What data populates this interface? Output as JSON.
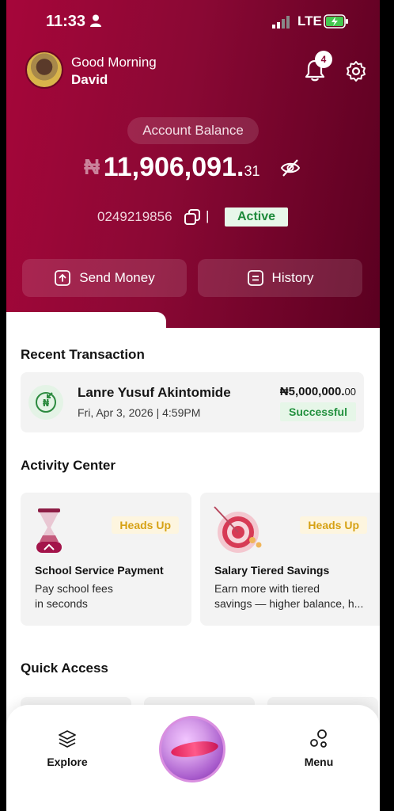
{
  "status_bar": {
    "time": "11:33",
    "network": "LTE"
  },
  "header": {
    "greeting": "Good Morning",
    "name": "David",
    "notification_count": "4"
  },
  "account": {
    "balance_label": "Account Balance",
    "currency": "₦",
    "balance_main": "11,906,091.",
    "balance_decimal": "31",
    "account_number": "0249219856",
    "separator": "|",
    "status": "Active"
  },
  "actions": {
    "send_money": "Send Money",
    "history": "History"
  },
  "recent_transaction": {
    "title": "Recent Transaction",
    "name": "Lanre Yusuf Akintomide",
    "date": "Fri, Apr 3, 2026 | 4:59PM",
    "amount_main": "₦5,000,000.",
    "amount_decimal": "00",
    "status": "Successful"
  },
  "activity_center": {
    "title": "Activity Center",
    "cards": [
      {
        "tag": "Heads Up",
        "title": "School Service Payment",
        "desc_line1": "Pay school fees",
        "desc_line2": "in seconds"
      },
      {
        "tag": "Heads Up",
        "title": "Salary Tiered Savings",
        "desc_line1": "Earn more with tiered",
        "desc_line2": "savings — higher balance, h..."
      }
    ]
  },
  "quick_access": {
    "title": "Quick Access"
  },
  "bottom_nav": {
    "explore": "Explore",
    "menu": "Menu"
  },
  "colors": {
    "brand": "#8a0834",
    "success": "#23913f",
    "warning": "#d6a114"
  },
  "icons": [
    "person-icon",
    "signal-icon",
    "battery-icon",
    "bell-icon",
    "gear-icon",
    "eye-off-icon",
    "copy-icon",
    "upload-icon",
    "history-icon",
    "exchange-icon",
    "layers-icon",
    "menu-circles-icon"
  ]
}
